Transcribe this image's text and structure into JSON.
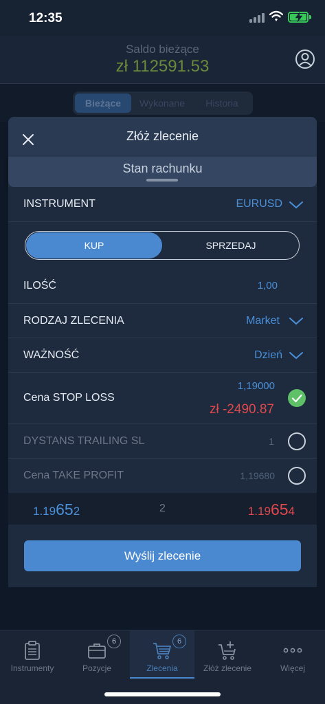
{
  "status": {
    "time": "12:35"
  },
  "header": {
    "saldo_label": "Saldo bieżące",
    "saldo_value": "zł 112591.53"
  },
  "segments": [
    {
      "label": "Bieżące",
      "active": true
    },
    {
      "label": "Wykonane",
      "active": false
    },
    {
      "label": "Historia",
      "active": false
    }
  ],
  "modal": {
    "title": "Złóż zlecenie",
    "tab_label": "Stan rachunku",
    "instrument": {
      "label": "INSTRUMENT",
      "value": "EURUSD"
    },
    "side": {
      "buy_label": "KUP",
      "sell_label": "SPRZEDAJ",
      "selected": "KUP"
    },
    "quantity": {
      "label": "ILOŚĆ",
      "value": "1,00"
    },
    "order_type": {
      "label": "RODZAJ ZLECENIA",
      "value": "Market"
    },
    "validity": {
      "label": "WAŻNOŚĆ",
      "value": "Dzień"
    },
    "stop_loss": {
      "label": "Cena STOP LOSS",
      "price": "1,19000",
      "amount": "zł -2490.87",
      "enabled": true
    },
    "trailing_sl": {
      "label": "DYSTANS TRAILING SL",
      "value": "1",
      "enabled": false
    },
    "take_profit": {
      "label": "Cena TAKE PROFIT",
      "value": "1,19680",
      "enabled": false
    },
    "quote": {
      "bid_prefix": "1.19",
      "bid_big": "65",
      "bid_suffix": "2",
      "spread": "2",
      "ask_prefix": "1.19",
      "ask_big": "65",
      "ask_suffix": "4"
    },
    "submit_label": "Wyślij zlecenie"
  },
  "tabbar": {
    "items": [
      {
        "label": "Instrumenty",
        "icon": "clipboard-icon",
        "active": false
      },
      {
        "label": "Pozycje",
        "icon": "briefcase-icon",
        "badge": "6",
        "active": false
      },
      {
        "label": "Zlecenia",
        "icon": "cart-icon",
        "badge": "6",
        "active": true
      },
      {
        "label": "Złóż zlecenie",
        "icon": "cart-plus-icon",
        "active": false
      },
      {
        "label": "Więcej",
        "icon": "more-icon",
        "active": false
      }
    ]
  },
  "colors": {
    "accent": "#4a88d0",
    "profit_green": "#6a8a3a",
    "loss_red": "#e0484c",
    "check_green": "#5ec167"
  }
}
